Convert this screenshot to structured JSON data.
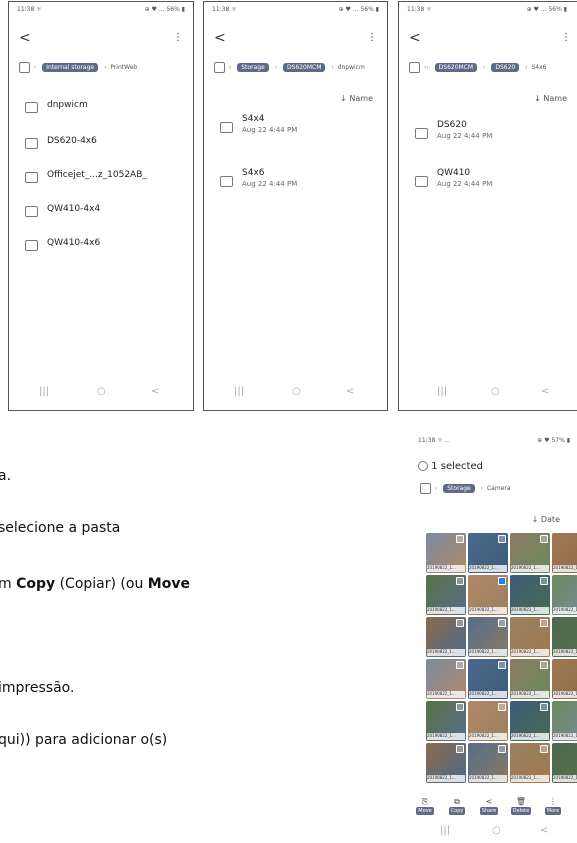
{
  "phone1": {
    "status_left": "11:38 ☼",
    "status_right": "⊕ ♥ ... 56% ▮",
    "crumb_chip": "Internal storage",
    "crumb_tail": "PrintWeb",
    "items": [
      "dnpwicm",
      "DS620-4x6",
      "Officejet_...z_1052AB_",
      "QW410-4x4",
      "QW410-4x6"
    ]
  },
  "phone2": {
    "status_left": "11:38 ☼",
    "status_right": "⊕ ♥ ... 56% ▮",
    "crumb_chip1": "Storage",
    "crumb_chip2": "DS620MCM",
    "crumb_tail": "dnpwicm",
    "sort_label": "↓ Name",
    "items": [
      {
        "name": "S4x4",
        "date": "Aug 22 4:44 PM"
      },
      {
        "name": "S4x6",
        "date": "Aug 22 4:44 PM"
      }
    ]
  },
  "phone3": {
    "status_left": "11:38 ☼",
    "status_right": "⊕ ♥ ... 56% ▮",
    "crumb_chip1": "DS620MCM",
    "crumb_chip2": "DS620",
    "crumb_tail": "S4x6",
    "sort_label": "↓ Name",
    "items": [
      {
        "name": "DS620",
        "date": "Aug 22 4:44 PM"
      },
      {
        "name": "QW410",
        "date": "Aug 22 4:44 PM"
      }
    ]
  },
  "phone4": {
    "status_left": "11:38 ☼ ...",
    "status_right": "⊕ ♥ 57% ▮",
    "selected_label": "1 selected",
    "crumb_chip": "Storage",
    "crumb_tail": "Camera",
    "sort_label": "↓ Date",
    "tile_caption": "20190822_1...",
    "toolbar": [
      "Move",
      "Copy",
      "Share",
      "Delete",
      "More"
    ]
  },
  "instructions": [
    {
      "pre": "a.",
      "bold": "",
      "post": ""
    },
    {
      "pre": "selecione a pasta",
      "bold": "",
      "post": ""
    },
    {
      "pre": "m ",
      "bold": "Copy",
      "post": " (Copiar) (ou ",
      "bold2": "Move"
    },
    {
      "pre": "impressão.",
      "bold": "",
      "post": ""
    },
    {
      "pre": "qui)) para adicionar o(s)",
      "bold": "",
      "post": ""
    }
  ],
  "nav": {
    "recent": "|||",
    "home": "○",
    "back": "<"
  }
}
